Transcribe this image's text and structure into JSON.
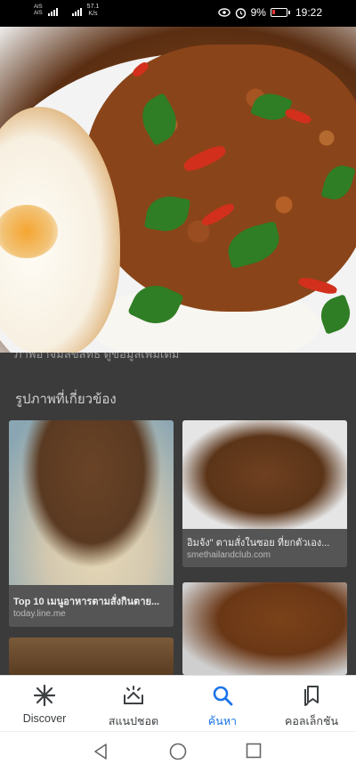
{
  "status_bar": {
    "carrier_1": "AIS",
    "carrier_2": "AIS",
    "network_speed_value": "57.1",
    "network_speed_unit": "K/s",
    "battery_percent": "9%",
    "time": "19:22",
    "icons": [
      "signal-icon",
      "eye-icon",
      "alarm-icon",
      "battery-icon"
    ]
  },
  "hero": {
    "image_name": "hero-image"
  },
  "results": {
    "cut_line": "ภาพอาจมีลิขสิทธิ์ ดูข้อมูลเพิ่มเติม",
    "related_heading": "รูปภาพที่เกี่ยวข้อง",
    "cards": [
      {
        "title": "Top 10 เมนูอาหารตามสั่งกินตาย...",
        "source": "today.line.me"
      },
      {
        "title": "อิมจัง\" ตามสั่งในซอย ที่ยกตัวเอง...",
        "source": "smethailandclub.com"
      },
      {
        "title": "",
        "source": ""
      },
      {
        "title": "",
        "source": ""
      }
    ]
  },
  "bottom_nav": {
    "items": [
      {
        "label": "Discover",
        "icon": "asterisk-icon"
      },
      {
        "label": "สแนปชอต",
        "icon": "snapshot-icon"
      },
      {
        "label": "ค้นหา",
        "icon": "search-icon"
      },
      {
        "label": "คอลเล็กชัน",
        "icon": "collections-icon"
      }
    ],
    "active_index": 2,
    "accent_color": "#1a73e8"
  },
  "system_nav": {
    "buttons": [
      "back-icon",
      "home-icon",
      "recents-icon"
    ]
  }
}
